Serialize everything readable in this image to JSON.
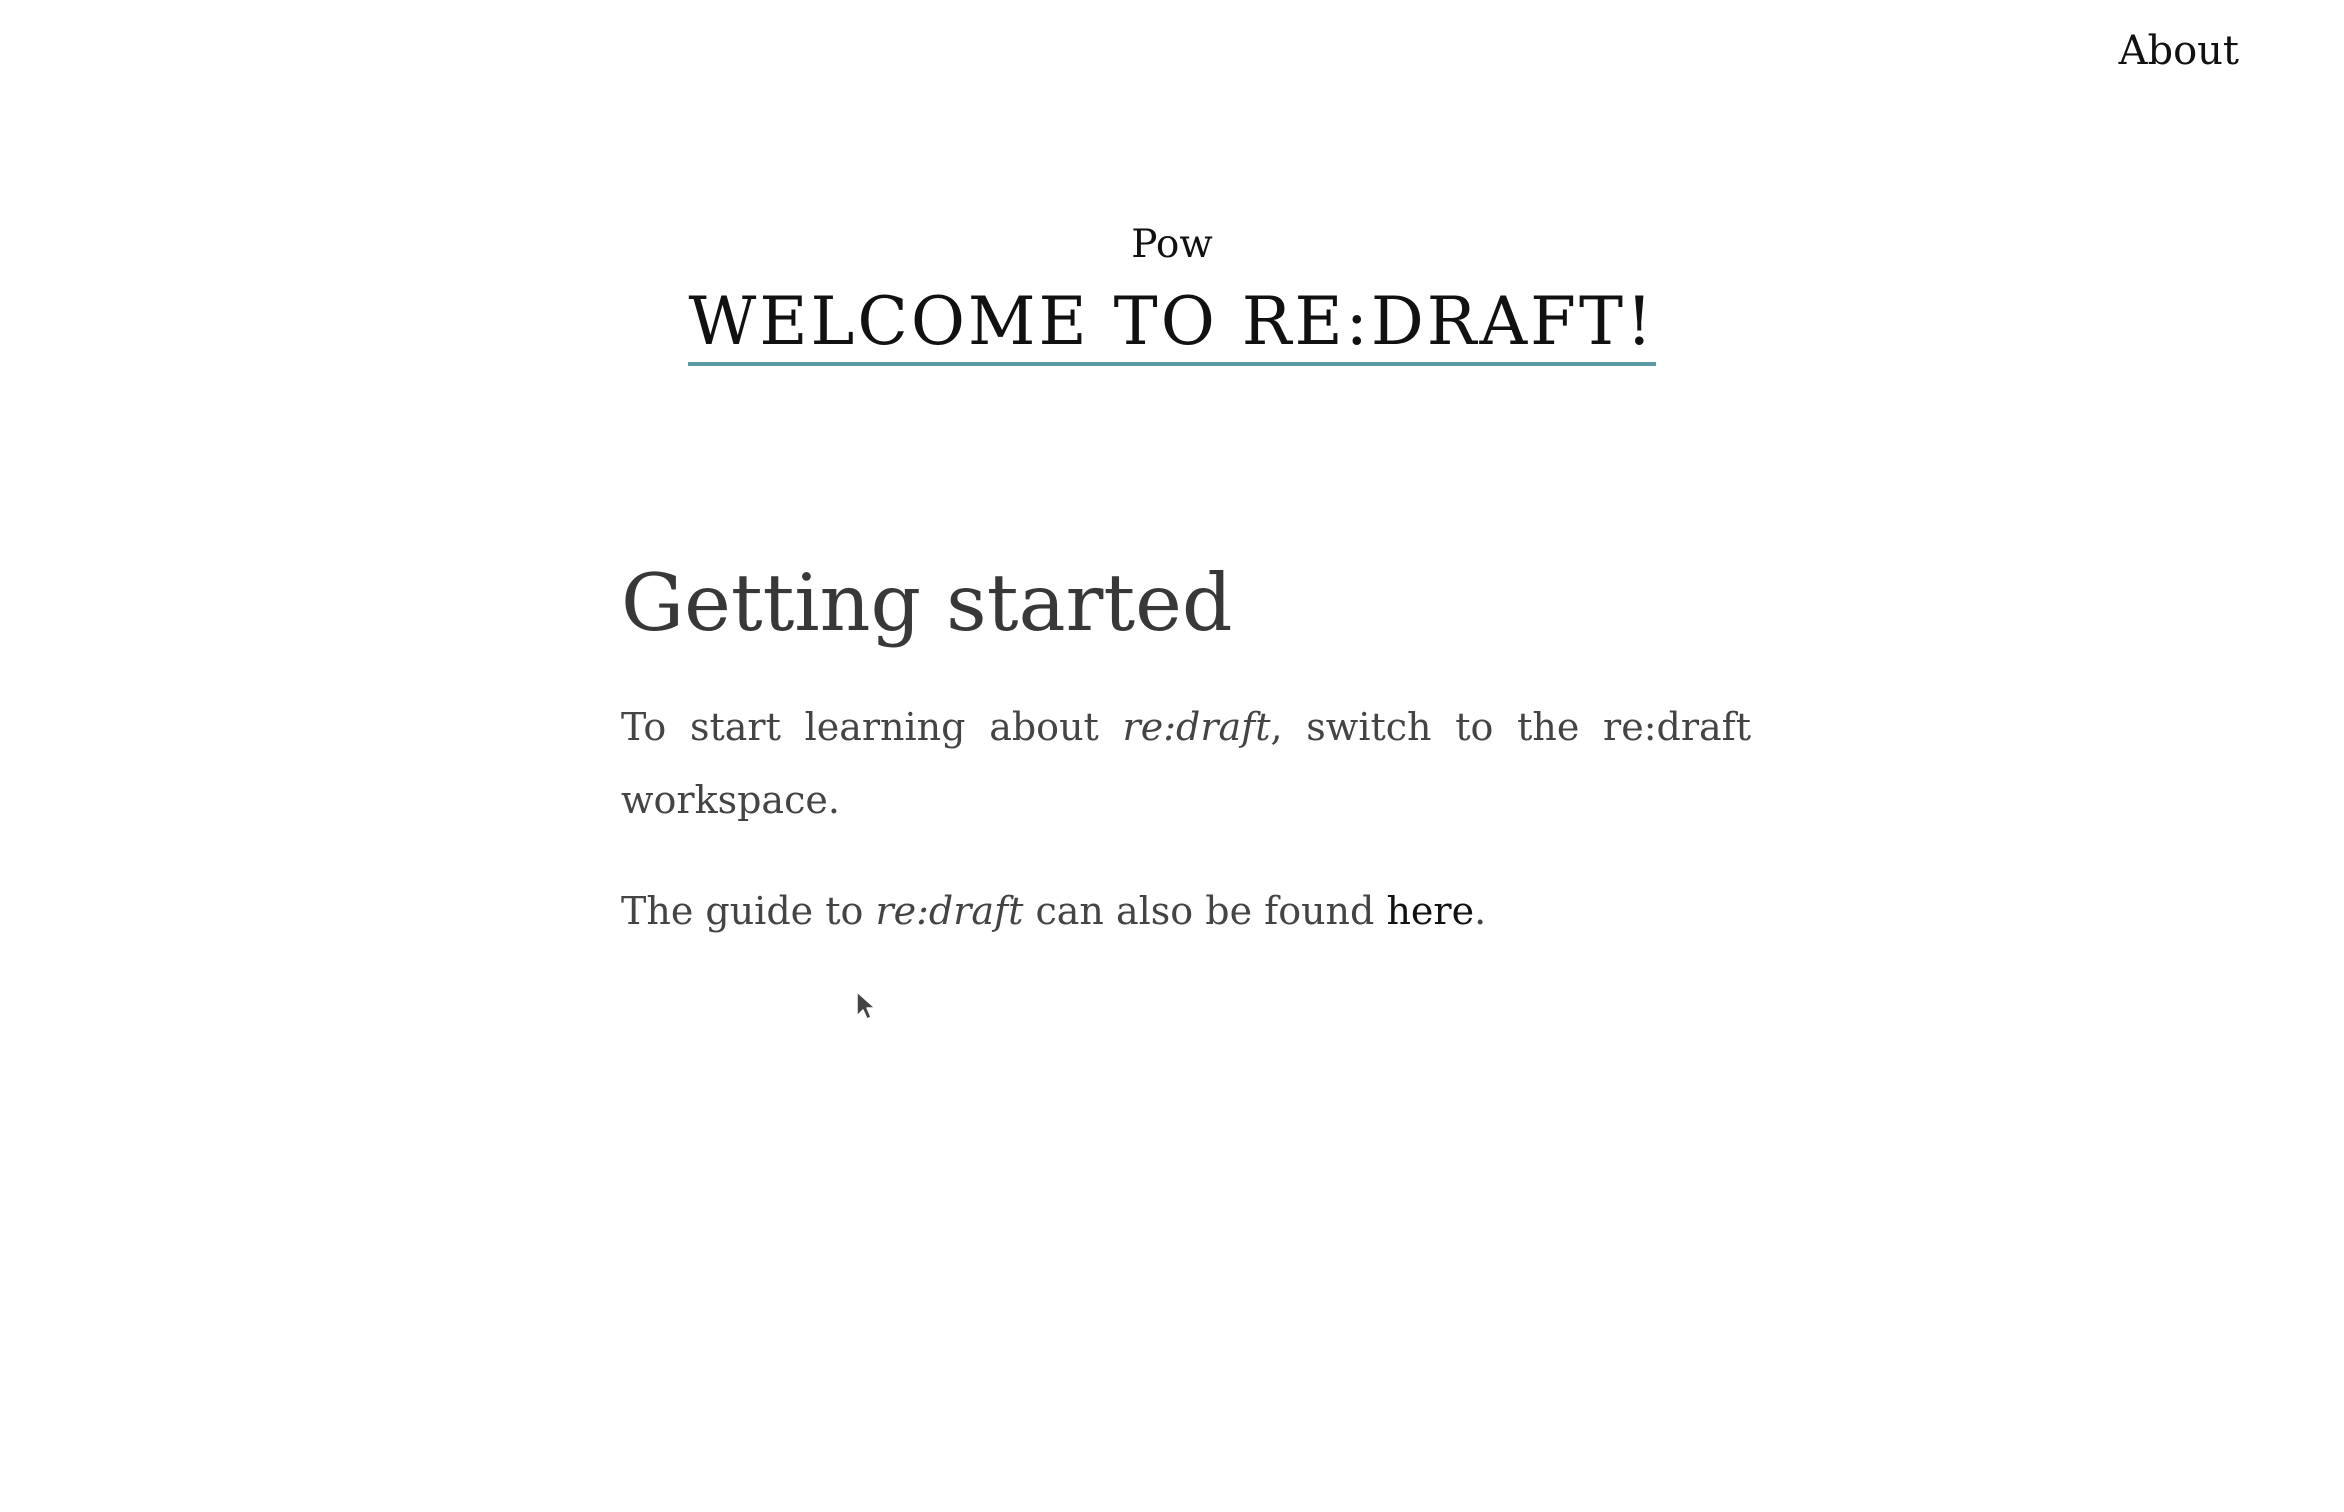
{
  "nav": {
    "about_label": "About"
  },
  "header": {
    "site_name": "Pow",
    "welcome_title": "WELCOME TO RE:DRAFT!"
  },
  "main": {
    "heading": "Getting started",
    "p1_before": "To start learning about ",
    "p1_em": "re:draft",
    "p1_after": ", switch to the re:draft workspace.",
    "p2_before": "The guide to ",
    "p2_em": "re:draft",
    "p2_middle": " can also be found ",
    "p2_link": "here",
    "p2_after": "."
  },
  "colors": {
    "underline_accent": "#5a9aa4",
    "body_text": "#444444"
  },
  "icons": {
    "cursor": "mouse-pointer-icon"
  }
}
